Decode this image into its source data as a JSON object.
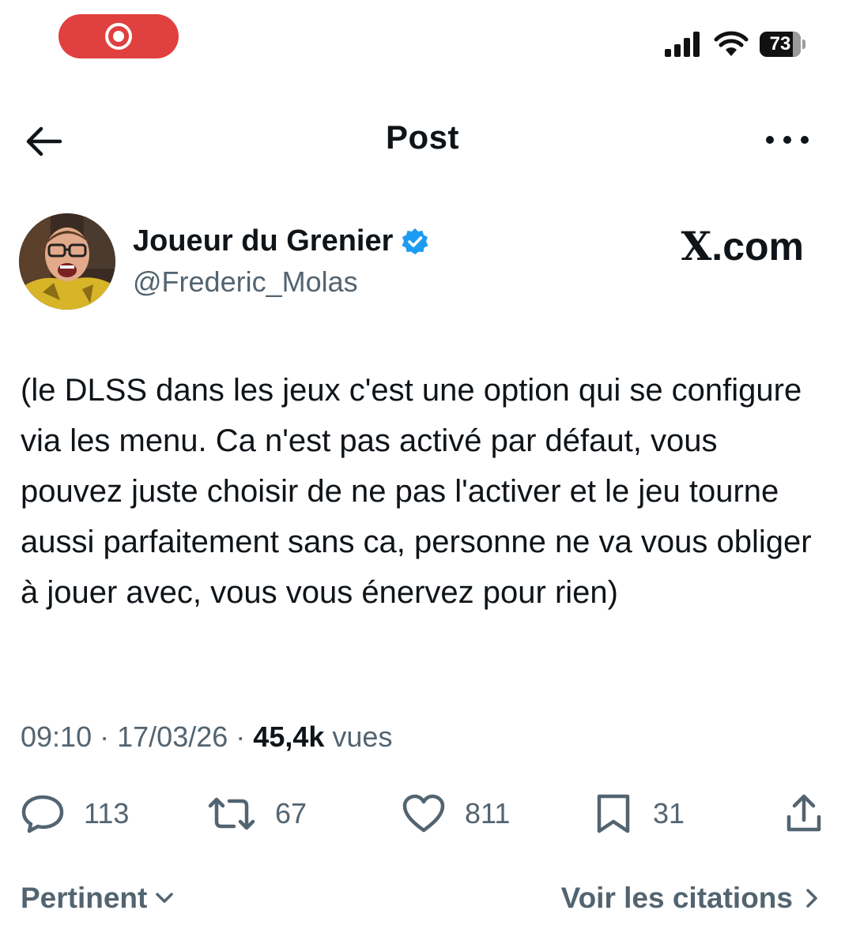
{
  "status_bar": {
    "record_icon": "screen-record-icon",
    "signal_icon": "cellular-signal-icon",
    "wifi_icon": "wifi-icon",
    "battery_level": "73"
  },
  "header": {
    "title": "Post",
    "back_icon": "back-arrow-icon",
    "more_icon": "more-options-icon"
  },
  "author": {
    "name": "Joueur du Grenier",
    "handle": "@Frederic_Molas",
    "verified_icon": "verified-badge-icon",
    "site_logo_x": "X",
    "site_logo_rest": ".com"
  },
  "post": {
    "text": "(le DLSS dans les jeux c'est une option qui se configure via les menu. Ca n'est pas activé par défaut, vous pouvez juste choisir de ne pas l'activer et le jeu tourne aussi parfaitement sans ca, personne ne va vous obliger à jouer avec, vous vous énervez pour rien)",
    "time": "09:10",
    "separator": "·",
    "date": "17/03/26",
    "views_count": "45,4k",
    "views_label": "vues"
  },
  "actions": {
    "replies": "113",
    "reposts": "67",
    "likes": "811",
    "bookmarks": "31",
    "reply_icon": "reply-icon",
    "repost_icon": "repost-icon",
    "like_icon": "heart-icon",
    "bookmark_icon": "bookmark-icon",
    "share_icon": "share-icon"
  },
  "footer": {
    "sort_label": "Pertinent",
    "quotes_label": "Voir les citations"
  },
  "colors": {
    "text_primary": "#0f1419",
    "text_secondary": "#536471",
    "verified_blue": "#1d9bf0",
    "record_red": "#e0403f"
  }
}
